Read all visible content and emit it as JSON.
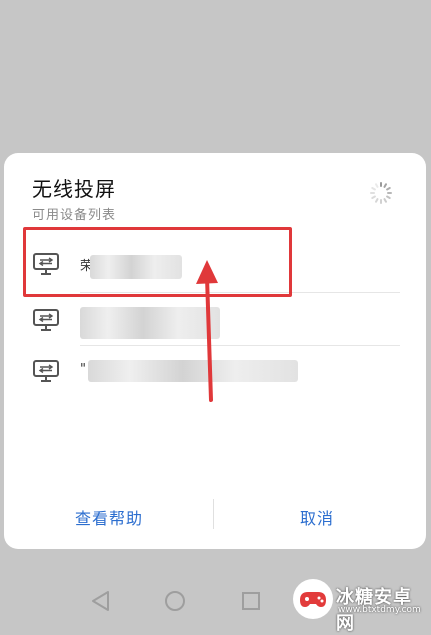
{
  "dialog": {
    "title": "无线投屏",
    "subtitle": "可用设备列表",
    "devices": [
      {
        "name_prefix": "荣"
      },
      {
        "name_prefix": ""
      },
      {
        "name_prefix": "\""
      }
    ],
    "help_label": "查看帮助",
    "cancel_label": "取消"
  },
  "annotation": {
    "highlight_color": "#e0383a"
  },
  "watermark": {
    "text": "冰糖安卓网",
    "url": "www.btxtdmy.com"
  },
  "colors": {
    "accent": "#2c6ecf",
    "overlay": "#c6c6c6"
  },
  "icons": [
    "monitor-icon",
    "loading-spinner-icon",
    "back-icon",
    "home-icon",
    "recents-icon"
  ]
}
